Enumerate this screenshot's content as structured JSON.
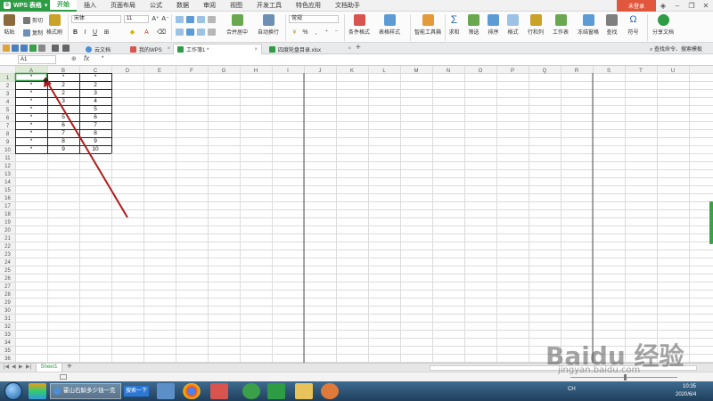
{
  "menu": {
    "app_label": "WPS 表格",
    "tabs": [
      "开始",
      "插入",
      "页面布局",
      "公式",
      "数据",
      "审阅",
      "视图",
      "开发工具",
      "特色应用",
      "文档助手"
    ],
    "active_tab": "开始",
    "login": "未登录"
  },
  "ribbon": {
    "paste": "粘贴",
    "cut": "剪切",
    "copy": "复制",
    "format_painter": "格式刷",
    "font_name": "宋体",
    "font_size": "11",
    "merge_center": "合并居中",
    "wrap_text": "自动换行",
    "number_format": "常规",
    "cond_format": "条件格式",
    "table_style": "表格样式",
    "smart_toolbox": "智能工具箱",
    "sum": "求和",
    "filter": "筛选",
    "sort": "排序",
    "format": "格式",
    "row_col": "行和列",
    "worksheet": "工作表",
    "freeze": "冻结窗格",
    "find": "查找",
    "symbol": "符号",
    "share_doc": "分享文档"
  },
  "doc_tabs": [
    {
      "label": "云文档"
    },
    {
      "label": "我的WPS"
    },
    {
      "label": "工作簿1 *"
    },
    {
      "label": "四度轮盘目录.xlsx"
    }
  ],
  "search_cmd": "查找命令、搜索模板",
  "formula_bar": {
    "name_box": "A1",
    "fx": "fx",
    "content": "*"
  },
  "grid": {
    "columns": [
      "A",
      "B",
      "C",
      "D",
      "E",
      "F",
      "G",
      "H",
      "I",
      "J",
      "K",
      "L",
      "M",
      "N",
      "O",
      "P",
      "Q",
      "R",
      "S",
      "T",
      "U"
    ],
    "row_count": 36,
    "cells": {
      "A": [
        "*",
        "*",
        "*",
        "*",
        "*",
        "*",
        "*",
        "*",
        "*",
        "*"
      ],
      "B": [
        "*",
        "2",
        "2",
        "3",
        "",
        "5",
        "6",
        "7",
        "8",
        "9"
      ],
      "C": [
        "*",
        "2",
        "3",
        "4",
        "5",
        "6",
        "7",
        "8",
        "9",
        "10"
      ]
    }
  },
  "sheet_tab": "Sheet1",
  "taskbar": {
    "task_label": "霍山石斛多少钱一克",
    "search_btn": "搜索一下",
    "tray": "CH",
    "time": "10:35",
    "date": "2020/6/4"
  },
  "watermark": {
    "brand": "Baidu 经验",
    "url": "jingyan.baidu.com"
  },
  "colors": {
    "wps_green": "#2e9b45",
    "annotation_arrow": "#b01c1c",
    "login_orange": "#e0573d"
  }
}
